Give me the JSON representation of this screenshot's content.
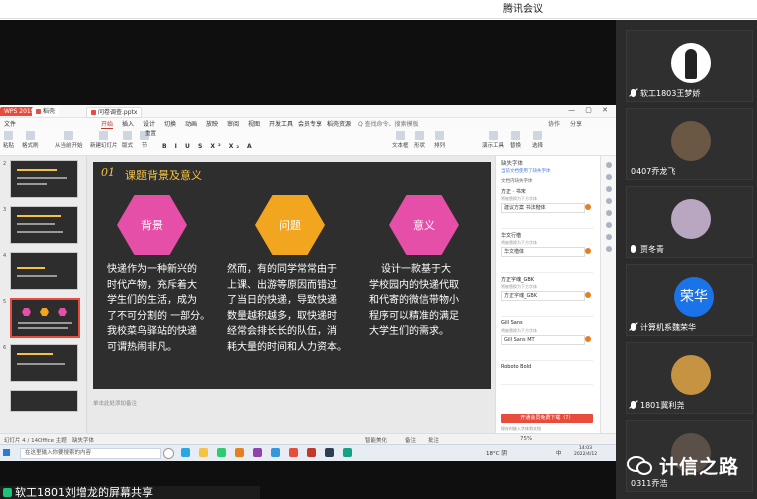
{
  "meeting": {
    "app_title": "腾讯会议",
    "share_banner": "软工1801刘增龙的屏幕共享"
  },
  "wps": {
    "tabs": [
      "WPS 2019",
      "稻壳",
      "问卷调查.pptx"
    ],
    "menu": [
      "文件",
      "开始",
      "插入",
      "设计",
      "切换",
      "动画",
      "放映",
      "审阅",
      "视图",
      "开发工具",
      "会员专享",
      "稻壳资源"
    ],
    "menu_search": "Q 查找命令、搜索模板",
    "menu_right": [
      "协作",
      "分享"
    ],
    "ribbon_buttons": [
      "粘贴",
      "格式刷",
      "从当前开始",
      "新建幻灯片",
      "版式",
      "节",
      "重置",
      "文本框",
      "形状",
      "排列",
      "演示工具",
      "替换",
      "选择"
    ],
    "status_left": [
      "幻灯片 4 / 14",
      "Office 主题",
      "缺失字体"
    ],
    "status_notes": "单击此处添加备注",
    "status_right": [
      "智能美化",
      "备注",
      "批注",
      "75%"
    ]
  },
  "slide": {
    "number": "01",
    "title": "课题背景及意义",
    "hexagons": [
      {
        "label": "背景",
        "color": "#e64fa8"
      },
      {
        "label": "问题",
        "color": "#f2a51f"
      },
      {
        "label": "意义",
        "color": "#e64fa8"
      }
    ],
    "col1": [
      "快递作为一种新兴的",
      "时代产物，充斥着大",
      "学生们的生活，成为",
      "了不可分割的 一部分。",
      "我校菜鸟驿站的快递",
      "可谓热闹非凡。"
    ],
    "col2": [
      "然而，有的同学常常由于",
      "上课、出游等原因而错过",
      "了当日的快递，导致快递",
      "数量越积越多，取快递时",
      "经常会排长长的队伍，消",
      "耗大量的时间和人力资本。"
    ],
    "col3": [
      "设计一款基于大",
      "学校园内的快递代取",
      "和代寄的微信带物小",
      "程序可以精准的满足",
      "大学生们的需求。"
    ]
  },
  "thumbnails": [
    "2",
    "3",
    "4",
    "5",
    "6"
  ],
  "font_panel": {
    "title": "缺失字体",
    "note": "当前文档使用了缺失字体",
    "subtitle": "文档内缺失字体",
    "fonts": [
      {
        "name": "方正 · 书宋",
        "sub": "将被替换为下方字体",
        "replacement": "建议方案 书法楷体"
      },
      {
        "name": "华文行楷",
        "sub": "将被替换为下方字体",
        "replacement": "华文楷体"
      },
      {
        "name": "方正字魂_GBK",
        "sub": "将被替换为下方字体",
        "replacement": "方正字魂_GBK"
      },
      {
        "name": "Gill Sans",
        "sub": "将被替换为下方字体",
        "replacement": "Gill Sans MT"
      },
      {
        "name": "Roboto Bold",
        "sub": "",
        "replacement": ""
      }
    ],
    "button": "开通会员免费下载（7）",
    "footer": "保存时嵌入字体到文档"
  },
  "taskbar": {
    "search_placeholder": "在这里输入你要搜索的内容",
    "weather": "18°C 阴",
    "time": "14:03",
    "date": "2022/4/12",
    "lang": "中"
  },
  "participants": [
    {
      "name": "软工1803王梦娇",
      "muted": true,
      "type": "photo",
      "color": "#ffffff"
    },
    {
      "name": "0407乔龙飞",
      "muted": false,
      "type": "photo",
      "color": "#6b5844"
    },
    {
      "name": "贾冬青",
      "muted": false,
      "type": "photo",
      "color": "#b9a7c2"
    },
    {
      "name": "计算机系魏荣华",
      "muted": true,
      "type": "text",
      "avatar_text": "荣华"
    },
    {
      "name": "1801冀利尧",
      "muted": true,
      "type": "photo",
      "color": "#c69342"
    },
    {
      "name": "0311乔浩",
      "muted": false,
      "type": "photo",
      "color": "#5b5048"
    }
  ],
  "watermark": "计信之路"
}
